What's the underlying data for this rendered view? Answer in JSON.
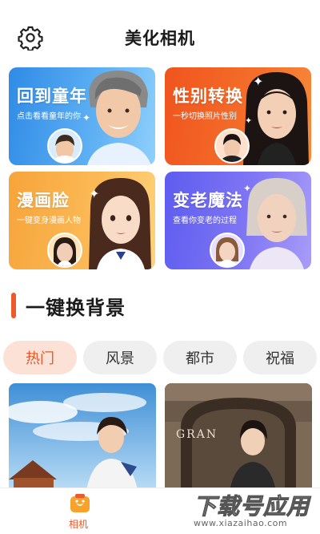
{
  "header": {
    "title": "美化相机",
    "settings_icon": "gear-icon"
  },
  "cards": [
    {
      "title": "回到童年",
      "subtitle": "点击看看童年的你",
      "color_from": "#2f8be6",
      "color_to": "#8fd0fb"
    },
    {
      "title": "性别转换",
      "subtitle": "一秒切换照片性别",
      "color_from": "#f0541e",
      "color_to": "#f78a3c"
    },
    {
      "title": "漫画脸",
      "subtitle": "一键变身漫画人物",
      "color_from": "#f7a43a",
      "color_to": "#ffd27a"
    },
    {
      "title": "变老魔法",
      "subtitle": "查看你变老的过程",
      "color_from": "#5e5cf0",
      "color_to": "#a89cf8"
    }
  ],
  "section": {
    "title": "一键换背景"
  },
  "categories": [
    {
      "label": "热门",
      "active": true
    },
    {
      "label": "风景",
      "active": false
    },
    {
      "label": "都市",
      "active": false
    },
    {
      "label": "祝福",
      "active": false
    }
  ],
  "photos": [
    {
      "sign_text": ""
    },
    {
      "sign_text": "GRAN"
    }
  ],
  "tabbar": {
    "camera_label": "相机",
    "camera_icon": "camera-tab-icon"
  },
  "watermark": {
    "main": "下载号应用",
    "url": "www.xiazaihao.com"
  },
  "colors": {
    "accent": "#e25a2a",
    "section_bar": "#ee5a2c",
    "chip_bg": "#efefef",
    "chip_active_bg": "#fbe1d6"
  }
}
